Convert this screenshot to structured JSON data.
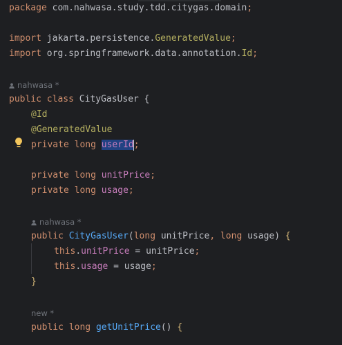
{
  "code": {
    "package_kw": "package",
    "package_name": "com.nahwasa.study.tdd.citygas.domain",
    "semicolon": ";",
    "import_kw": "import",
    "import1_pkg": "jakarta.persistence.",
    "import1_cls": "GeneratedValue",
    "import2_pkg": "org.springframework.data.annotation.",
    "import2_cls": "Id",
    "class_author": "nahwasa *",
    "public_kw": "public",
    "class_kw": "class",
    "class_name": "CityGasUser",
    "open_brace": " {",
    "ann_id": "@Id",
    "ann_generated": "@GeneratedValue",
    "private_kw": "private",
    "long_kw": "long",
    "field_userid": "userId",
    "field_unitprice": "unitPrice",
    "field_usage": "usage",
    "ctor_author": "nahwasa *",
    "ctor_name": "CityGasUser",
    "param_unitprice": "unitPrice",
    "param_usage": "usage",
    "this_kw": "this",
    "close_brace": "}",
    "new_hint": "new *",
    "getter_name": "getUnitPrice"
  }
}
